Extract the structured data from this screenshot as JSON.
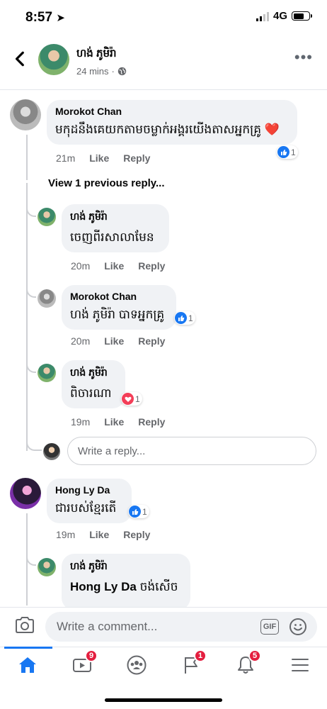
{
  "status_bar": {
    "time": "8:57",
    "network": "4G"
  },
  "header": {
    "name": "ហង់ ភូមិរ៉ា",
    "time": "24 mins",
    "separator": "·"
  },
  "comments": [
    {
      "author": "Morokot Chan",
      "text": "មកុដនឹងគេយកតាមចម្លាក់អង្គរយើងតាសអ្នកគ្រូ ❤️",
      "time": "21m",
      "like": "Like",
      "reply": "Reply",
      "reaction_count": "1"
    },
    {
      "view_previous": "View 1 previous reply..."
    },
    {
      "author": "ហង់ ភូមិរ៉ា",
      "text": "ចេញពីរសាលាមែន",
      "time": "20m",
      "like": "Like",
      "reply": "Reply"
    },
    {
      "author": "Morokot Chan",
      "text": "ហង់ ភូមិរ៉ា បាទអ្នកគ្រូ",
      "time": "20m",
      "like": "Like",
      "reply": "Reply",
      "reaction_count": "1"
    },
    {
      "author": "ហង់ ភូមិរ៉ា",
      "text": "ពិចារណា",
      "time": "19m",
      "like": "Like",
      "reply": "Reply",
      "reaction_count": "1"
    },
    {
      "reply_placeholder": "Write a reply..."
    },
    {
      "author": "Hong Ly Da",
      "text": "ជារបស់ខ្មែរតើ",
      "time": "19m",
      "like": "Like",
      "reply": "Reply",
      "reaction_count": "1"
    },
    {
      "author": "ហង់ ភូមិរ៉ា",
      "mention": "Hong Ly Da",
      "text": "ចង់សើច"
    }
  ],
  "composer": {
    "placeholder": "Write a comment...",
    "gif_label": "GIF"
  },
  "tabs": [
    {
      "name": "home",
      "badge": ""
    },
    {
      "name": "watch",
      "badge": "9"
    },
    {
      "name": "groups",
      "badge": ""
    },
    {
      "name": "pages",
      "badge": "1"
    },
    {
      "name": "notifications",
      "badge": "5"
    },
    {
      "name": "menu",
      "badge": ""
    }
  ],
  "colors": {
    "accent": "#1877f2",
    "bubble": "#f0f2f5",
    "badge": "#e41e3f",
    "love": "#f33e58"
  }
}
